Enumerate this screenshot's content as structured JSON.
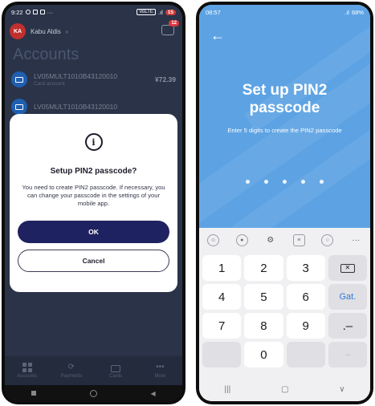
{
  "left_phone": {
    "status": {
      "time": "9:22",
      "network": "VoLTE",
      "battery": "15"
    },
    "header": {
      "avatar_initials": "KA",
      "user_name": "Kabu Aldis",
      "chevron": "›",
      "message_badge": "12"
    },
    "page_title": "Accounts",
    "accounts": [
      {
        "number": "LV05MULT1010B43120010",
        "type": "Card account",
        "amount": "¥72.39"
      },
      {
        "number": "LV05MULT1010B43120010",
        "type": "",
        "amount": ""
      }
    ],
    "dialog": {
      "icon": "i",
      "title": "Setup PIN2 passcode?",
      "body": "You need to create PIN2 passcode. If necessary, you can change your passcode in the settings of your mobile app.",
      "ok_label": "OK",
      "cancel_label": "Cancel"
    },
    "bottom_nav": [
      {
        "label": "Accounts",
        "icon": "grid-icon"
      },
      {
        "label": "Payments",
        "icon": "payments-icon"
      },
      {
        "label": "Cards",
        "icon": "card-icon"
      },
      {
        "label": "More",
        "icon": "more-icon"
      }
    ],
    "colors": {
      "dim_bg": "#2a3348",
      "primary_button": "#1f2260",
      "badge": "#d9363e"
    }
  },
  "right_phone": {
    "status": {
      "time": "08:57",
      "battery": "68%"
    },
    "back_icon": "←",
    "title_line1": "Set up PIN2",
    "title_line2": "passcode",
    "subtitle": "Enter 5 digits to create the PIN2 passcode",
    "pin_dots_count": 5,
    "toolbar_icons": [
      "emoji-icon",
      "mic-icon",
      "settings-icon",
      "clipboard-icon",
      "search-icon",
      "more-icon"
    ],
    "keys": [
      "1",
      "2",
      "3",
      "⌫",
      "4",
      "5",
      "6",
      "Gat.",
      "7",
      "8",
      "9",
      ".–",
      "",
      "0",
      "",
      "–"
    ],
    "colors": {
      "header_bg": "#5da3e4",
      "accent": "#2f7bd4"
    }
  }
}
